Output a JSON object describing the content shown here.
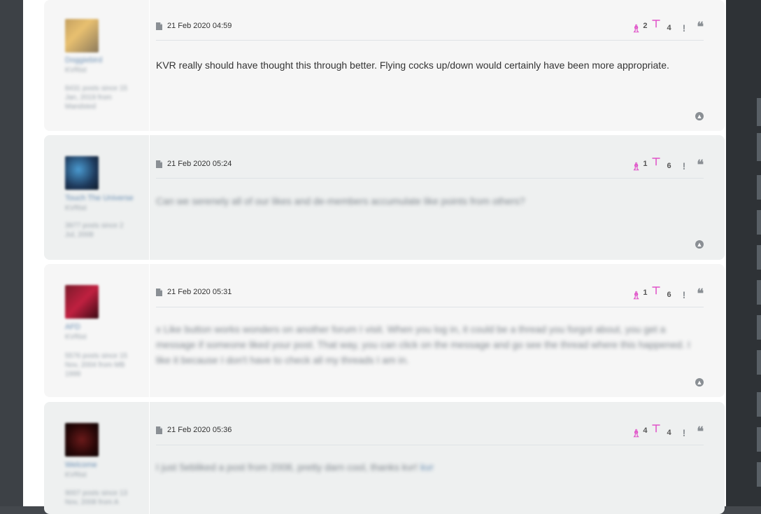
{
  "colors": {
    "accent_reaction": "#e054c9",
    "background": "#44484d"
  },
  "posts": [
    {
      "date": "21 Feb 2020 04:59",
      "reaction_up_count": "2",
      "reaction_down_count": "4",
      "author": "Doggiebird",
      "rank": "KVRist",
      "posts_line": "8431 posts since 15 Jan, 2019 from Mandsted",
      "content": "KVR really should have thought this through better. Flying cocks up/down would certainly have been more appropriate."
    },
    {
      "date": "21 Feb 2020 05:24",
      "reaction_up_count": "1",
      "reaction_down_count": "6",
      "author": "Touch The Universe",
      "rank": "KVRist",
      "posts_line": "3977 posts since 2 Jul, 2008",
      "content": "Can we serenely all of our likes and de-members accumulate like points from others?"
    },
    {
      "date": "21 Feb 2020 05:31",
      "reaction_up_count": "1",
      "reaction_down_count": "6",
      "author": "AFD",
      "rank": "KVRist",
      "posts_line": "5576 posts since 15 Nov, 2004 from MB 1999",
      "content": "x Like button works wonders on another forum I visit. When you log in, it could be a thread you forgot about, you get a message if someone liked your post. That way, you can click on the message and go see the thread where this happened. I like it because I don't have to check all my threads I am in."
    },
    {
      "date": "21 Feb 2020 05:36",
      "reaction_up_count": "4",
      "reaction_down_count": "4",
      "author": "Welcome",
      "rank": "KVRist",
      "posts_line": "9007 posts since 13 Nov, 2008 from A",
      "content": "I just 5ebliked a post from 2008, pretty darn cool, thanks kvr!",
      "content_tag": "kvr"
    }
  ],
  "icons": {
    "post": "document-icon",
    "reaction_up": "reaction-up-icon",
    "reaction_down": "reaction-down-icon",
    "warn": "exclamation-icon",
    "quote": "quote-icon",
    "top": "chevron-up-icon"
  }
}
